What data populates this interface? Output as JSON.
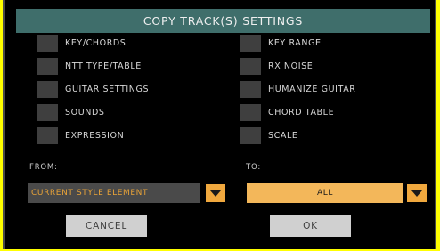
{
  "dialog": {
    "title": "COPY TRACK(S) SETTINGS"
  },
  "options": {
    "left": [
      {
        "label": "KEY/CHORDS",
        "checked": false
      },
      {
        "label": "NTT TYPE/TABLE",
        "checked": false
      },
      {
        "label": "GUITAR SETTINGS",
        "checked": false
      },
      {
        "label": "SOUNDS",
        "checked": false
      },
      {
        "label": "EXPRESSION",
        "checked": false
      }
    ],
    "right": [
      {
        "label": "KEY RANGE",
        "checked": false
      },
      {
        "label": "RX NOISE",
        "checked": false
      },
      {
        "label": "HUMANIZE GUITAR",
        "checked": false
      },
      {
        "label": "CHORD TABLE",
        "checked": false
      },
      {
        "label": "SCALE",
        "checked": false
      }
    ]
  },
  "from": {
    "label": "FROM:",
    "value": "CURRENT STYLE ELEMENT"
  },
  "to": {
    "label": "TO:",
    "value": "ALL"
  },
  "buttons": {
    "cancel": "CANCEL",
    "ok": "OK"
  },
  "colors": {
    "background": "#ffff00",
    "title_bar": "#3f6e6b",
    "checkbox": "#3f3f3f",
    "from_text": "#e8a338",
    "to_field": "#f3b75a",
    "dropdown_arrow": "#f0a83e",
    "button": "#d0d0d0"
  },
  "icons": {
    "dropdown": "triangle-down-icon"
  }
}
